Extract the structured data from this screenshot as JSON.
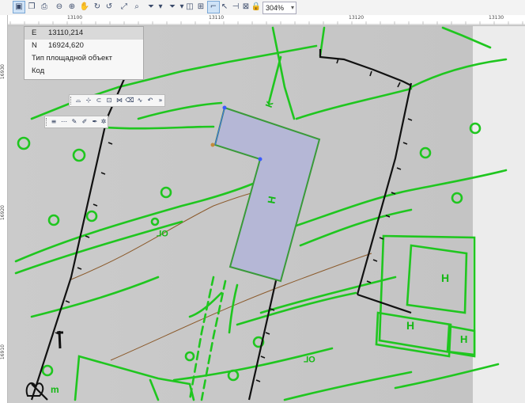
{
  "toolbar": {
    "icons": [
      "select-icon",
      "copy-icon",
      "print-icon",
      "zoom-out-icon",
      "zoom-in-icon",
      "pan-icon",
      "rotate-icon",
      "rotate-back-icon",
      "zoom-extent-icon",
      "zoom-window-icon",
      "filter-icon",
      "filter-select-icon",
      "layers-icon",
      "measure-icon",
      "snap-icon",
      "flip-icon",
      "lock-icon",
      "grid-icon"
    ],
    "zoom_value": "304%"
  },
  "ruler": {
    "top_labels": [
      "13100",
      "13110",
      "13120",
      "13130"
    ],
    "left_labels": [
      "16930",
      "16920",
      "16910"
    ]
  },
  "info_panel": {
    "rows": [
      {
        "key": "E",
        "value": "13110,214"
      },
      {
        "key": "N",
        "value": "16924,620"
      },
      {
        "key": "Тип площадной объект",
        "value": ""
      },
      {
        "key": "Код",
        "value": ""
      }
    ]
  },
  "map": {
    "symbol_labels": [
      "Н",
      "Н",
      "Н",
      "Н",
      "Н",
      "ОГ",
      "ОГ",
      "Г",
      "m",
      "К"
    ],
    "colors": {
      "background": "#c9c9c9",
      "line_green": "#1fc61f",
      "line_black": "#111111",
      "line_brown": "#8b5a2b",
      "polygon_fill": "#b5b7d6",
      "polygon_stroke": "#3a9a3a"
    }
  }
}
